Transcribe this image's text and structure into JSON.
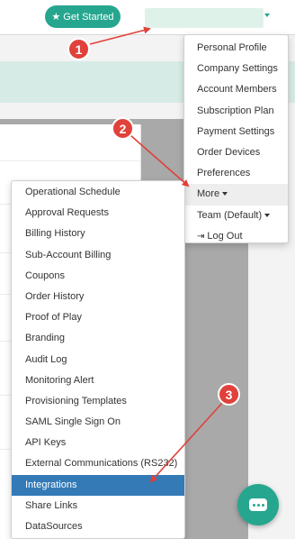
{
  "topbar": {
    "get_started_label": "Get Started",
    "get_started_icon": "star-icon",
    "brand_color": "#26a68f"
  },
  "user_menu": {
    "items": [
      {
        "label": "Personal Profile"
      },
      {
        "label": "Company Settings"
      },
      {
        "label": "Account Members"
      },
      {
        "label": "Subscription Plan"
      },
      {
        "label": "Payment Settings"
      },
      {
        "label": "Order Devices"
      },
      {
        "label": "Preferences"
      },
      {
        "label": "More",
        "has_caret": true,
        "hover": true
      },
      {
        "label": "Team (Default)",
        "has_caret": true
      },
      {
        "label": "Log Out",
        "icon": "logout-icon"
      }
    ]
  },
  "more_submenu": {
    "items": [
      {
        "label": "Operational Schedule"
      },
      {
        "label": "Approval Requests"
      },
      {
        "label": "Billing History"
      },
      {
        "label": "Sub-Account Billing"
      },
      {
        "label": "Coupons"
      },
      {
        "label": "Order History"
      },
      {
        "label": "Proof of Play"
      },
      {
        "label": "Branding"
      },
      {
        "label": "Audit Log"
      },
      {
        "label": "Monitoring Alert"
      },
      {
        "label": "Provisioning Templates"
      },
      {
        "label": "SAML Single Sign On"
      },
      {
        "label": "API Keys"
      },
      {
        "label": "External Communications (RS232)"
      },
      {
        "label": "Integrations",
        "active": true
      },
      {
        "label": "Share Links"
      },
      {
        "label": "DataSources"
      }
    ],
    "active_color": "#337ab7"
  },
  "annotations": {
    "step_1": "1",
    "step_2": "2",
    "step_3": "3",
    "color": "#e0413a"
  },
  "chat": {
    "icon": "chat-icon"
  }
}
